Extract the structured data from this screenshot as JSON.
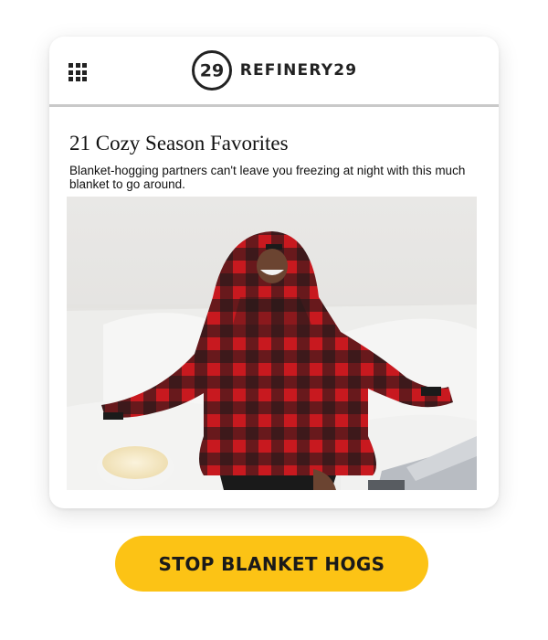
{
  "header": {
    "brand_name": "REFINERY29",
    "logo_text": "29",
    "menu_icon": "grid-icon"
  },
  "article": {
    "title": "21 Cozy Season Favorites",
    "description": "Blanket-hogging partners can't leave you freezing at night with this much blanket to go around."
  },
  "cta": {
    "label": "STOP BLANKET HOGS"
  },
  "colors": {
    "cta_background": "#fcc315",
    "plaid_red": "#c8191f",
    "plaid_black": "#1a1a1a",
    "text": "#111111",
    "divider": "#c9c9c9"
  }
}
